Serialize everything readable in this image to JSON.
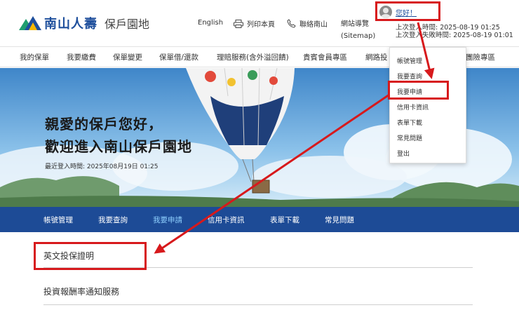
{
  "header": {
    "logo_text": "南山人壽",
    "logo_subtitle": "保戶園地",
    "english_label": "English",
    "print_label": "列印本頁",
    "contact_label": "聯絡南山",
    "sitemap_label": "網站導覽",
    "sitemap_sub": "(Sitemap)",
    "greeting_link": "您好！",
    "last_login": "上次登入時間: 2025-08-19 01:25",
    "last_failed_login": "上次登入失敗時間: 2025-08-19 01:01"
  },
  "main_nav": {
    "items": [
      "我的保單",
      "我要繳費",
      "保單變更",
      "保單借/還款",
      "理賠服務(含外溢回饋)",
      "貴賓會員專區",
      "網路投",
      "團險專區"
    ]
  },
  "dropdown": {
    "items": [
      "帳號管理",
      "我要查詢",
      "我要申請",
      "信用卡資訊",
      "表單下載",
      "常見問題",
      "登出"
    ]
  },
  "banner": {
    "greeting_line1": "親愛的保戶您好，",
    "greeting_line2": "歡迎進入南山保戶園地",
    "last_login": "最近登入時間: 2025年08月19日 01:25"
  },
  "sub_nav": {
    "items": [
      "帳號管理",
      "我要查詢",
      "我要申請",
      "信用卡資訊",
      "表單下載",
      "常見問題"
    ],
    "active_index": 2
  },
  "content": {
    "items": [
      "英文投保證明",
      "投資報酬率通知服務"
    ]
  },
  "colors": {
    "brand_blue": "#1e4f9c",
    "subnav_bg": "#1d4b96",
    "subnav_active": "#8fd0ff",
    "annotation_red": "#d7191c"
  }
}
